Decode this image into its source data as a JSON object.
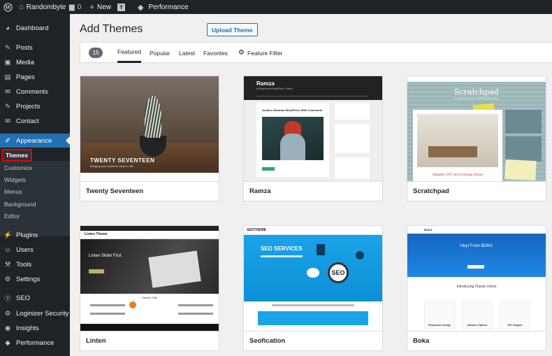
{
  "adminbar": {
    "site_name": "Randombyte",
    "comments_count": "0",
    "new_label": "New",
    "performance_label": "Performance"
  },
  "sidebar": {
    "items": [
      {
        "label": "Dashboard",
        "icon": "dashboard-icon",
        "glyph": "◕"
      },
      {
        "label": "Posts",
        "icon": "pushpin-icon",
        "glyph": "✎"
      },
      {
        "label": "Media",
        "icon": "media-icon",
        "glyph": "▣"
      },
      {
        "label": "Pages",
        "icon": "pages-icon",
        "glyph": "▤"
      },
      {
        "label": "Comments",
        "icon": "comment-icon",
        "glyph": "✉"
      },
      {
        "label": "Projects",
        "icon": "pushpin-icon",
        "glyph": "✎"
      },
      {
        "label": "Contact",
        "icon": "mail-icon",
        "glyph": "✉"
      },
      {
        "label": "Appearance",
        "icon": "paintbrush-icon",
        "glyph": "✐"
      },
      {
        "label": "Plugins",
        "icon": "plugin-icon",
        "glyph": "⚡"
      },
      {
        "label": "Users",
        "icon": "users-icon",
        "glyph": "☺"
      },
      {
        "label": "Tools",
        "icon": "wrench-icon",
        "glyph": "⚒"
      },
      {
        "label": "Settings",
        "icon": "settings-icon",
        "glyph": "⚙"
      },
      {
        "label": "SEO",
        "icon": "seo-icon",
        "glyph": "Ⓨ"
      },
      {
        "label": "Loginizer Security",
        "icon": "gear-icon",
        "glyph": "⚙"
      },
      {
        "label": "Insights",
        "icon": "insights-icon",
        "glyph": "◉"
      },
      {
        "label": "Performance",
        "icon": "performance-icon",
        "glyph": "◆"
      }
    ],
    "submenu": [
      "Themes",
      "Customize",
      "Widgets",
      "Menus",
      "Background",
      "Editor"
    ]
  },
  "page": {
    "title": "Add Themes",
    "upload_label": "Upload Theme"
  },
  "filter": {
    "count": "15",
    "tabs": [
      "Featured",
      "Popular",
      "Latest",
      "Favorites"
    ],
    "feature_filter": "Feature Filter"
  },
  "themes": [
    {
      "name": "Twenty Seventeen",
      "shot_title": "TWENTY SEVENTEEN",
      "shot_tagline": "Bringing your business ideas to life"
    },
    {
      "name": "Ramza",
      "shot_title": "Ramza",
      "shot_tagline": "A Responsive WordPress Theme",
      "shot_post": "Another Random WordPress With Comments"
    },
    {
      "name": "Scratchpad",
      "shot_title": "Scratchpad",
      "shot_tagline": "a colorful theme for collecting your ideas",
      "shot_post": "Simple DIY decorating ideas"
    },
    {
      "name": "Linten",
      "shot_title": "Linten Theme",
      "shot_hero": "Linten Slider First",
      "shot_section": "Service Title"
    },
    {
      "name": "Seofication",
      "shot_title": "SEOTHEME",
      "shot_hero": "SEO SERVICES",
      "shot_badge": "SEO"
    },
    {
      "name": "Boka",
      "shot_title": "BOKA",
      "shot_hero": "Hey! From BOKA",
      "shot_section": "Introducing Classic Demo",
      "shot_features": [
        "Responsive design",
        "Advance Options",
        "24/7 Support"
      ]
    }
  ],
  "colors": {
    "admin_dark": "#1d2327",
    "accent": "#2271b1",
    "highlight_box": "#e00000"
  }
}
